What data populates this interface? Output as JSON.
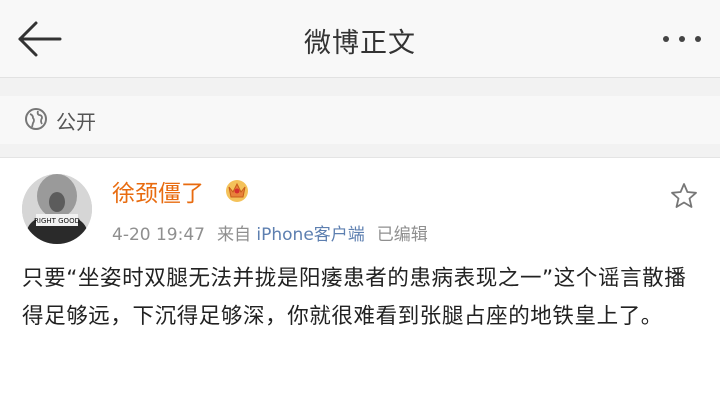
{
  "navbar": {
    "title": "微博正文",
    "back_icon": "arrow-left-icon",
    "more_icon": "more-dots-icon"
  },
  "visibility": {
    "icon": "globe-icon",
    "label": "公开"
  },
  "post": {
    "avatar_text": "RIGHT GOOD",
    "username": "徐颈僵了",
    "badge_icon": "crown-icon",
    "time": "4-20 19:47",
    "from_label": "来自",
    "device": "iPhone客户端",
    "edited": "已编辑",
    "favorite_icon": "star-icon",
    "content": "只要“坐姿时双腿无法并拢是阳痿患者的患病表现之一”这个谣言散播得足够远，下沉得足够深，你就很难看到张腿占座的地铁皇上了。"
  },
  "colors": {
    "username": "#e86b0f",
    "link": "#5d7fb0",
    "meta": "#8f8f8f",
    "background_gray": "#f2f2f2"
  }
}
